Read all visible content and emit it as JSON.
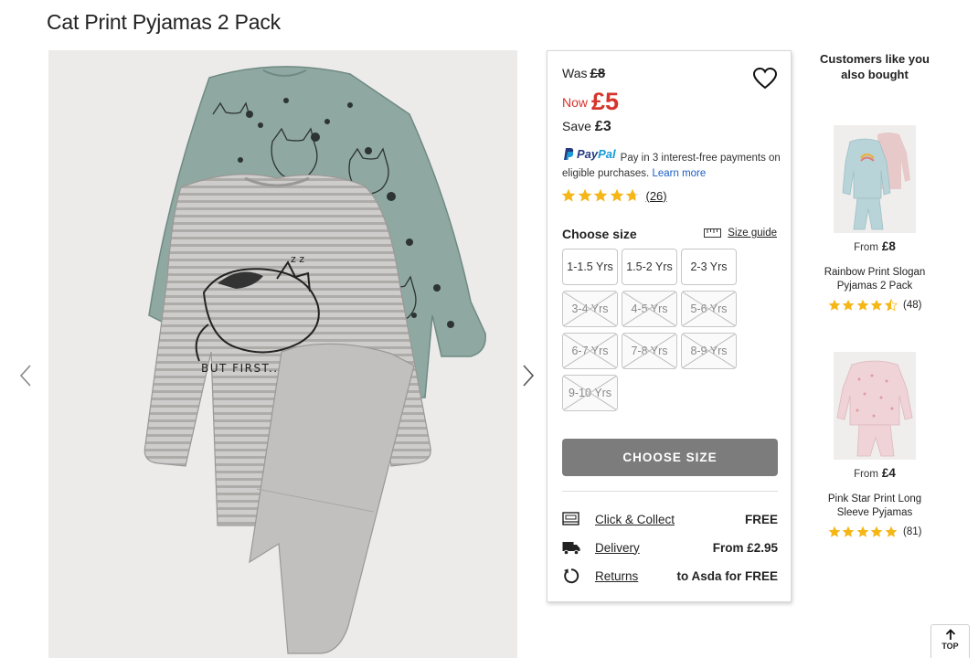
{
  "product": {
    "title": "Cat Print Pyjamas 2 Pack"
  },
  "price": {
    "was_label": "Was",
    "was_value": "£8",
    "now_label": "Now",
    "now_value": "£5",
    "save_label": "Save",
    "save_value": "£3"
  },
  "paypal": {
    "logo_pay": "Pay",
    "logo_pal": "Pal",
    "text": "Pay in 3 interest-free payments on eligible purchases.",
    "learn_more": "Learn more"
  },
  "rating": {
    "stars": 4.5,
    "count": "(26)"
  },
  "size_section": {
    "label": "Choose size",
    "guide_label": "Size guide"
  },
  "sizes": [
    {
      "label": "1-1.5 Yrs",
      "available": true
    },
    {
      "label": "1.5-2 Yrs",
      "available": true
    },
    {
      "label": "2-3 Yrs",
      "available": true
    },
    {
      "label": "3-4 Yrs",
      "available": false
    },
    {
      "label": "4-5 Yrs",
      "available": false
    },
    {
      "label": "5-6 Yrs",
      "available": false
    },
    {
      "label": "6-7 Yrs",
      "available": false
    },
    {
      "label": "7-8 Yrs",
      "available": false
    },
    {
      "label": "8-9 Yrs",
      "available": false
    },
    {
      "label": "9-10 Yrs",
      "available": false
    }
  ],
  "cta": {
    "label": "CHOOSE SIZE"
  },
  "services": [
    {
      "icon": "click-collect-icon",
      "label": "Click & Collect",
      "value": "FREE"
    },
    {
      "icon": "delivery-truck-icon",
      "label": "Delivery",
      "value": "From £2.95"
    },
    {
      "icon": "returns-icon",
      "label": "Returns",
      "value": "to Asda for FREE"
    }
  ],
  "gallery": {
    "print_text": "BUT FIRST...CAT N"
  },
  "recommendations": {
    "title": "Customers like you also bought",
    "items": [
      {
        "from_label": "From",
        "price": "£8",
        "name": "Rainbow Print Slogan Pyjamas 2 Pack",
        "stars": 4.5,
        "count": "(48)"
      },
      {
        "from_label": "From",
        "price": "£4",
        "name": "Pink Star Print Long Sleeve Pyjamas",
        "stars": 5,
        "count": "(81)"
      }
    ]
  },
  "top_button": {
    "label": "TOP"
  },
  "colors": {
    "sale_red": "#d6342c",
    "star_gold": "#f5b617",
    "paypal_dark": "#253b80",
    "paypal_light": "#179bd7",
    "link_blue": "#1a5dc6",
    "cta_grey": "#7c7c7c"
  }
}
